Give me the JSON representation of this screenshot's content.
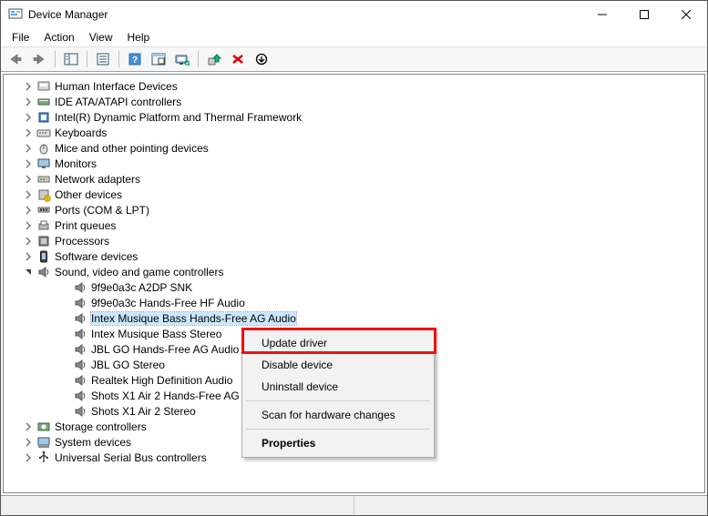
{
  "window": {
    "title": "Device Manager"
  },
  "menubar": [
    "File",
    "Action",
    "View",
    "Help"
  ],
  "tree": {
    "categories": [
      {
        "label": "Human Interface Devices",
        "icon": "hid"
      },
      {
        "label": "IDE ATA/ATAPI controllers",
        "icon": "ide"
      },
      {
        "label": "Intel(R) Dynamic Platform and Thermal Framework",
        "icon": "chip"
      },
      {
        "label": "Keyboards",
        "icon": "keyboard"
      },
      {
        "label": "Mice and other pointing devices",
        "icon": "mouse"
      },
      {
        "label": "Monitors",
        "icon": "monitor"
      },
      {
        "label": "Network adapters",
        "icon": "network"
      },
      {
        "label": "Other devices",
        "icon": "other"
      },
      {
        "label": "Ports (COM & LPT)",
        "icon": "port"
      },
      {
        "label": "Print queues",
        "icon": "printer"
      },
      {
        "label": "Processors",
        "icon": "cpu"
      },
      {
        "label": "Software devices",
        "icon": "software"
      },
      {
        "label": "Sound, video and game controllers",
        "icon": "sound",
        "expanded": true,
        "children": [
          {
            "label": "9f9e0a3c A2DP SNK"
          },
          {
            "label": "9f9e0a3c Hands-Free HF Audio"
          },
          {
            "label": "Intex Musique Bass Hands-Free AG Audio",
            "selected": true
          },
          {
            "label": "Intex Musique Bass Stereo"
          },
          {
            "label": "JBL GO Hands-Free AG Audio"
          },
          {
            "label": "JBL GO Stereo"
          },
          {
            "label": "Realtek High Definition Audio"
          },
          {
            "label": "Shots X1 Air 2 Hands-Free AG Audio"
          },
          {
            "label": "Shots X1 Air 2 Stereo"
          }
        ]
      },
      {
        "label": "Storage controllers",
        "icon": "storage"
      },
      {
        "label": "System devices",
        "icon": "system"
      },
      {
        "label": "Universal Serial Bus controllers",
        "icon": "usb"
      }
    ]
  },
  "contextMenu": {
    "items": [
      {
        "label": "Update driver",
        "highlight": true
      },
      {
        "label": "Disable device"
      },
      {
        "label": "Uninstall device"
      },
      {
        "sep": true
      },
      {
        "label": "Scan for hardware changes"
      },
      {
        "sep": true
      },
      {
        "label": "Properties",
        "bold": true
      }
    ]
  }
}
